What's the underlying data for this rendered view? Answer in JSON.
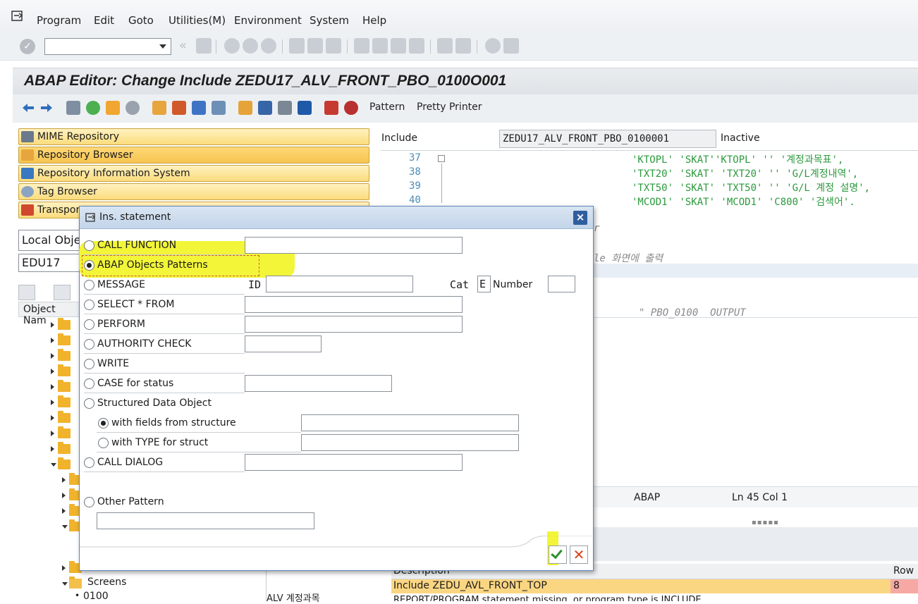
{
  "menu": {
    "items": [
      "Program",
      "Edit",
      "Goto",
      "Utilities(M)",
      "Environment",
      "System",
      "Help"
    ]
  },
  "toolbar": {
    "command_field_value": "",
    "back_glyph": "«"
  },
  "title": "ABAP Editor: Change Include ZEDU17_ALV_FRONT_PBO_0100O001",
  "app_toolbar": {
    "pattern_label": "Pattern",
    "pretty_printer_label": "Pretty Printer"
  },
  "nav": {
    "buttons": [
      "MIME Repository",
      "Repository Browser",
      "Repository Information System",
      "Tag Browser",
      "Transport"
    ],
    "object_type": "Local Obje",
    "object_name": "EDU17",
    "tree_header": "Object Nam",
    "tree_screens": "Screens",
    "tree_0100": "0100",
    "tree_0100_desc": "ALV 계정과목"
  },
  "editor": {
    "include_label": "Include",
    "include_value": "ZEDU17_ALV_FRONT_PBO_0100001",
    "status": "Inactive",
    "lines": [
      {
        "num": "37",
        "code": "'KTOPL' 'SKAT''KTOPL' '' '계정과목표',"
      },
      {
        "num": "38",
        "code": "'TXT20' 'SKAT' 'TXT20' '' 'G/L계정내역',"
      },
      {
        "num": "39",
        "code": "'TXT50' 'SKAT' 'TXT50' '' 'G/L 계정 설명',"
      },
      {
        "num": "40",
        "code": "'MCOD1' 'SKAT' 'MCOD1' 'C800' '검색어'."
      }
    ],
    "comment1": "r",
    "comment2": "le 화면에 출력",
    "comment3": "\" PBO_0100  OUTPUT",
    "status_lang": "ABAP",
    "status_pos": "Ln  45 Col   1",
    "splitter": "▪▪▪▪▪"
  },
  "messages": {
    "header_desc": "Description",
    "header_row": "Row",
    "row1_text": "Include ZEDU_AVL_FRONT_TOP",
    "row1_num": "8",
    "row2_text": "REPORT/PROGRAM statement missing, or program type is INCLUDE"
  },
  "dialog": {
    "title": "Ins. statement",
    "close": "×",
    "options": {
      "call_function": "CALL FUNCTION",
      "abap_objects": "ABAP Objects Patterns",
      "message": "MESSAGE",
      "select": "SELECT * FROM",
      "perform": "PERFORM",
      "authority": "AUTHORITY CHECK",
      "write": "WRITE",
      "case": "CASE for status",
      "structured": "Structured Data Object",
      "with_fields": "with fields from structure",
      "with_type": "with TYPE for struct",
      "call_dialog": "CALL DIALOG",
      "other": "Other Pattern"
    },
    "message_id_label": "ID",
    "message_cat_label": "Cat",
    "message_cat_value": "E",
    "message_number_label": "Number",
    "cancel_glyph": "✕"
  },
  "colors": {
    "highlight": "#eef200",
    "nav_button": "#fbdc7c",
    "dialog_header": "#c3d5ea",
    "error_row": "#fbd682"
  }
}
